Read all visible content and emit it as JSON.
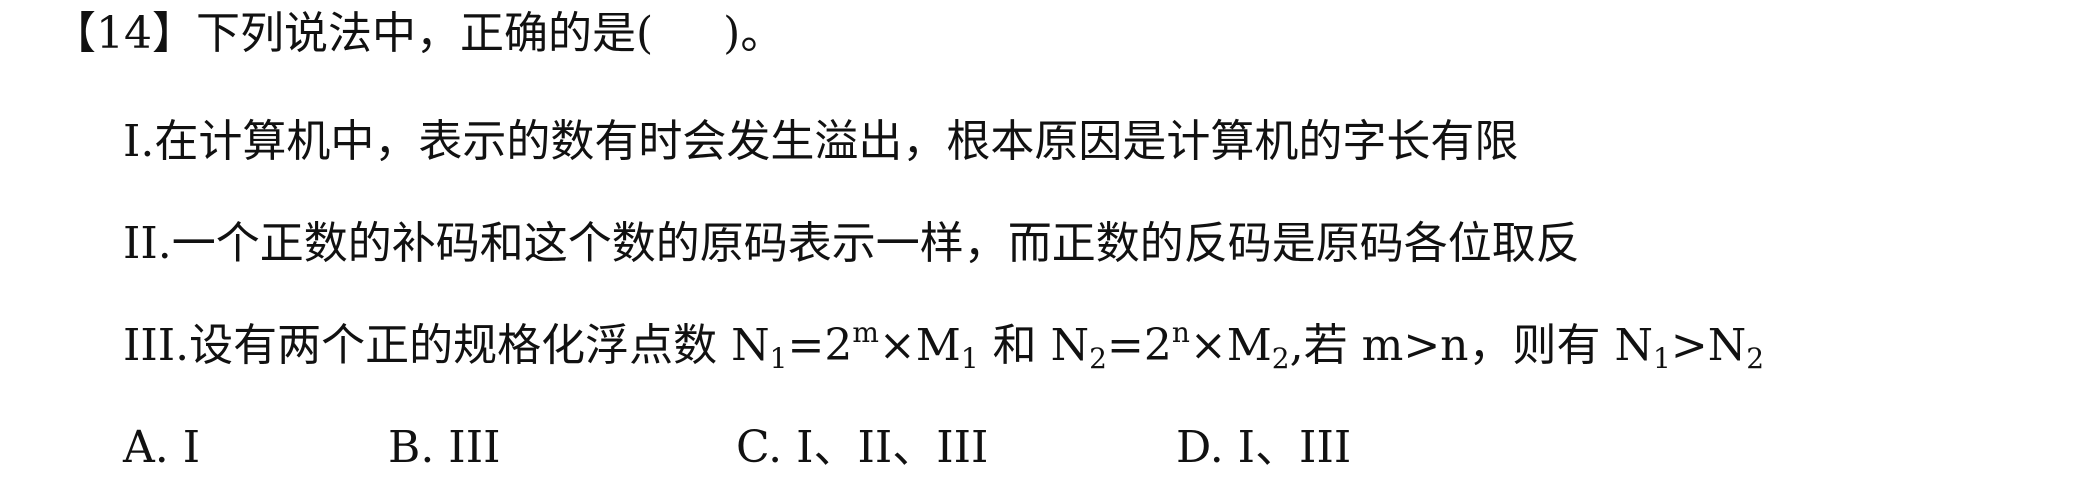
{
  "question": {
    "bracket_open": "【",
    "number": "14",
    "bracket_close": "】",
    "stem_before": "下列说法中，正确的是(",
    "stem_after": ")。"
  },
  "statements": {
    "s1": "I.在计算机中，表示的数有时会发生溢出，根本原因是计算机的字长有限",
    "s2": "II.一个正数的补码和这个数的原码表示一样，而正数的反码是原码各位取反",
    "s3": {
      "prefix": "III.设有两个正的规格化浮点数 N",
      "n1_sub": "1",
      "eq1": "=2",
      "exp_m": "m",
      "times1": "×M",
      "m1_sub": "1",
      "mid": " 和 N",
      "n2_sub": "2",
      "eq2": "=2",
      "exp_n": "n",
      "times2": "×M",
      "m2_sub": "2",
      "cond": ",若 m>n，则有 N",
      "n1b_sub": "1",
      "gt": ">N",
      "n2b_sub": "2"
    }
  },
  "options": {
    "a": "A. I",
    "b": "B. III",
    "c": "C. I、II、III",
    "d": "D. I、III"
  }
}
